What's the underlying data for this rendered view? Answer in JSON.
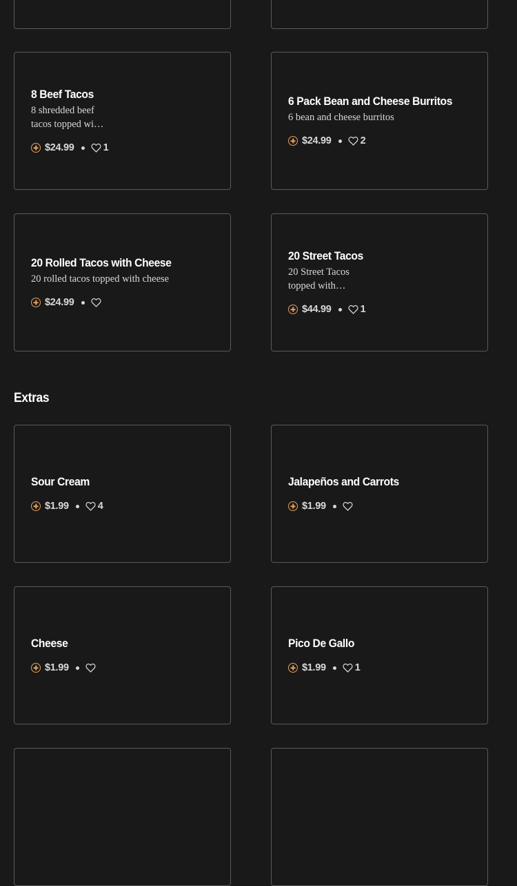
{
  "section_extras": "Extras",
  "colors": {
    "background": "#191919",
    "accent": "#e8a05a",
    "border": "#5a5a5a"
  },
  "items": [
    {
      "title": "8 Beef Tacos",
      "desc": "8 shredded beef tacos topped wi…",
      "price": "$24.99",
      "likes": "1"
    },
    {
      "title": "6 Pack Bean and Cheese Burritos",
      "desc": "6 bean and cheese burritos",
      "price": "$24.99",
      "likes": "2"
    },
    {
      "title": "20 Rolled Tacos with Cheese",
      "desc": "20 rolled tacos topped with cheese",
      "price": "$24.99",
      "likes": ""
    },
    {
      "title": "20 Street Tacos",
      "desc": "20 Street Tacos topped with…",
      "price": "$44.99",
      "likes": "1"
    },
    {
      "title": "Sour Cream",
      "desc": "",
      "price": "$1.99",
      "likes": "4"
    },
    {
      "title": "Jalapeños and Carrots",
      "desc": "",
      "price": "$1.99",
      "likes": ""
    },
    {
      "title": "Cheese",
      "desc": "",
      "price": "$1.99",
      "likes": ""
    },
    {
      "title": "Pico De Gallo",
      "desc": "",
      "price": "$1.99",
      "likes": "1"
    }
  ]
}
